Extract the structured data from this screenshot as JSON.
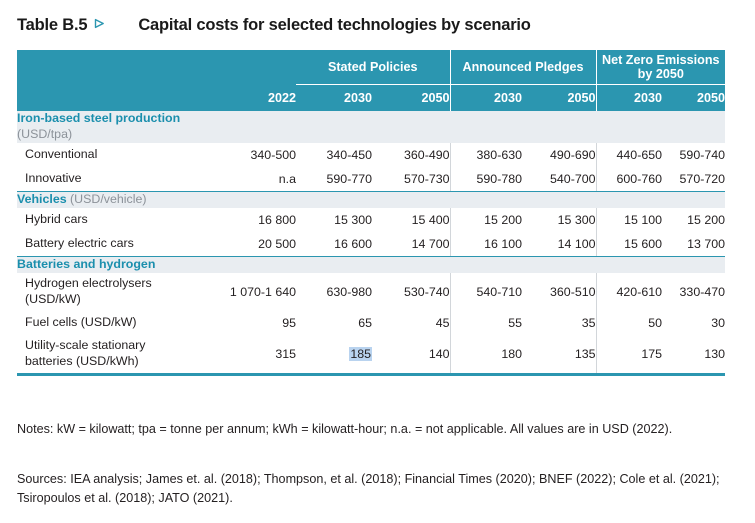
{
  "title": {
    "label": "Table B.5",
    "marker_icon": "triangle-right-icon",
    "text": "Capital costs for selected technologies by scenario"
  },
  "colors": {
    "header_teal": "#2b96b0",
    "section_band": "#e9edf1",
    "section_title": "#1b8fad",
    "section_unit": "#8c9299",
    "selection_highlight": "#b9d3ef",
    "rule_teal": "#2b96b0"
  },
  "table": {
    "groups": [
      {
        "label": "",
        "span": 2
      },
      {
        "label": "Stated Policies",
        "span": 2
      },
      {
        "label": "Announced Pledges",
        "span": 2
      },
      {
        "label": "Net Zero Emissions by 2050",
        "span": 2
      }
    ],
    "year_headers": [
      "",
      "2022",
      "2030",
      "2050",
      "2030",
      "2050",
      "2030",
      "2050"
    ],
    "sections": [
      {
        "name": "Iron-based steel production",
        "unit": "(USD/tpa)",
        "unit_block": true,
        "rows": [
          {
            "label": "Conventional",
            "values": [
              "340-500",
              "340-450",
              "360-490",
              "380-630",
              "490-690",
              "440-650",
              "590-740"
            ]
          },
          {
            "label": "Innovative",
            "values": [
              "n.a",
              "590-770",
              "570-730",
              "590-780",
              "540-700",
              "600-760",
              "570-720"
            ]
          }
        ]
      },
      {
        "name": "Vehicles",
        "unit": "(USD/vehicle)",
        "unit_block": false,
        "rows": [
          {
            "label": "Hybrid cars",
            "values": [
              "16 800",
              "15 300",
              "15 400",
              "15 200",
              "15 300",
              "15 100",
              "15 200"
            ]
          },
          {
            "label": "Battery electric cars",
            "values": [
              "20 500",
              "16 600",
              "14 700",
              "16 100",
              "14 100",
              "15 600",
              "13 700"
            ]
          }
        ]
      },
      {
        "name": "Batteries and hydrogen",
        "unit": "",
        "unit_block": false,
        "rows": [
          {
            "label": "Hydrogen electrolysers (USD/kW)",
            "label_line1": "Hydrogen electrolysers",
            "label_line2": "(USD/kW)",
            "tall": true,
            "values": [
              "1 070-1 640",
              "630-980",
              "530-740",
              "540-710",
              "360-510",
              "420-610",
              "330-470"
            ]
          },
          {
            "label": "Fuel cells (USD/kW)",
            "tall": false,
            "values": [
              "95",
              "65",
              "45",
              "55",
              "35",
              "50",
              "30"
            ]
          },
          {
            "label": "Utility-scale stationary batteries (USD/kWh)",
            "label_line1": "Utility-scale stationary",
            "label_line2": "batteries (USD/kWh)",
            "tall": true,
            "values": [
              "315",
              "185",
              "140",
              "180",
              "135",
              "175",
              "130"
            ],
            "selected_index": 1
          }
        ]
      }
    ]
  },
  "notes": {
    "note_1": "Notes: kW = kilowatt; tpa = tonne per annum; kWh = kilowatt-hour; n.a. = not applicable. All values are in USD (2022).",
    "note_2": "Sources: IEA analysis; James et. al. (2018); Thompson, et al. (2018); Financial Times (2020); BNEF (2022); Cole et al. (2021); Tsiropoulos et al. (2018); JATO (2021)."
  }
}
